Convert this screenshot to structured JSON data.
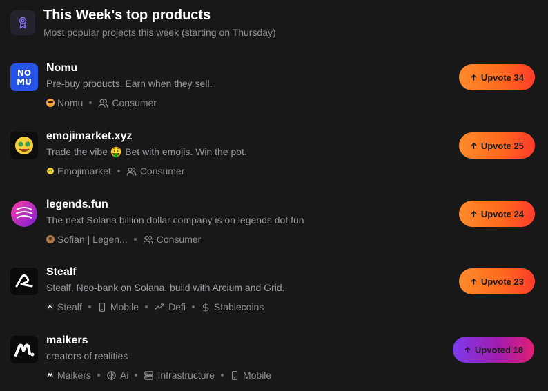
{
  "header": {
    "title": "This Week's top products",
    "subtitle": "Most popular projects this week (starting on Thursday)",
    "icon": "award-icon"
  },
  "colors": {
    "background": "#181819",
    "upvote_gradient_start": "#ff8a2a",
    "upvote_gradient_end": "#ff3c2a",
    "upvoted_gradient_start": "#7c3aed",
    "upvoted_gradient_end": "#e11d74"
  },
  "products": [
    {
      "name": "Nomu",
      "tagline": "Pre-buy products. Earn when they sell.",
      "maker": "Nomu",
      "categories": [
        {
          "icon": "users-icon",
          "label": "Consumer"
        }
      ],
      "upvote_label": "Upvote",
      "upvote_count": "34"
    },
    {
      "name": "emojimarket.xyz",
      "tagline": "Trade the vibe 🤑 Bet with emojis. Win the pot.",
      "maker": "Emojimarket",
      "categories": [
        {
          "icon": "users-icon",
          "label": "Consumer"
        }
      ],
      "upvote_label": "Upvote",
      "upvote_count": "25"
    },
    {
      "name": "legends.fun",
      "tagline": "The next Solana billion dollar company is on legends dot fun",
      "maker": "Sofian | Legen...",
      "categories": [
        {
          "icon": "users-icon",
          "label": "Consumer"
        }
      ],
      "upvote_label": "Upvote",
      "upvote_count": "24"
    },
    {
      "name": "Stealf",
      "tagline": "Stealf, Neo-bank on Solana, build with Arcium and Grid.",
      "maker": "Stealf",
      "categories": [
        {
          "icon": "mobile-icon",
          "label": "Mobile"
        },
        {
          "icon": "trending-up-icon",
          "label": "Defi"
        },
        {
          "icon": "dollar-icon",
          "label": "Stablecoins"
        }
      ],
      "upvote_label": "Upvote",
      "upvote_count": "23"
    },
    {
      "name": "maikers",
      "tagline": "creators of realities",
      "maker": "Maikers",
      "categories": [
        {
          "icon": "brain-icon",
          "label": "Ai"
        },
        {
          "icon": "server-icon",
          "label": "Infrastructure"
        },
        {
          "icon": "mobile-icon",
          "label": "Mobile"
        }
      ],
      "upvote_label": "Upvoted",
      "upvote_count": "18"
    }
  ]
}
